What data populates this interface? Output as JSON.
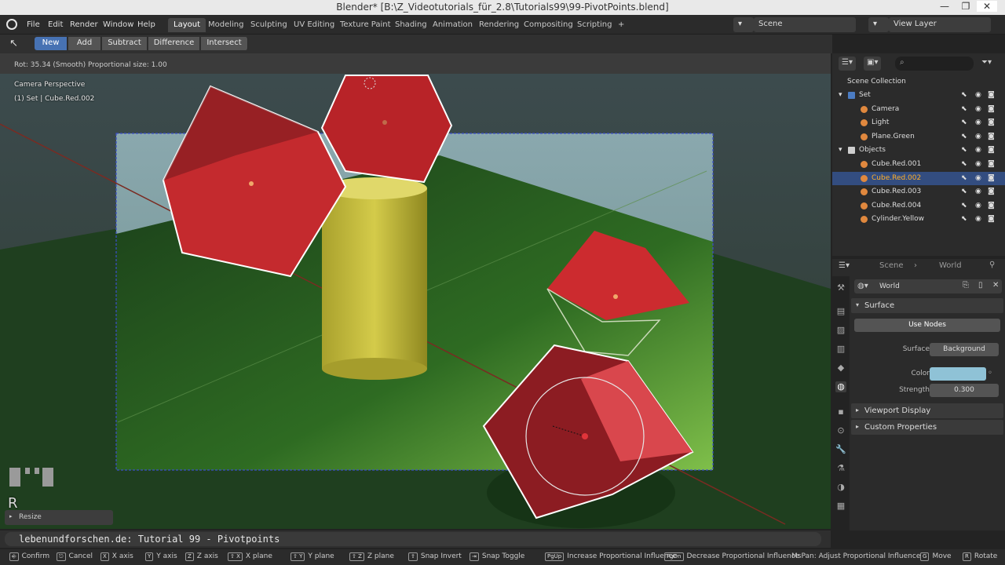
{
  "window": {
    "title": "Blender* [B:\\Z_Videotutorials_für_2.8\\Tutorials99\\99-PivotPoints.blend]",
    "minimize": "—",
    "maximize": "❐",
    "close": "✕"
  },
  "menu": [
    "File",
    "Edit",
    "Render",
    "Window",
    "Help"
  ],
  "workspaces": [
    "Layout",
    "Modeling",
    "Sculpting",
    "UV Editing",
    "Texture Paint",
    "Shading",
    "Animation",
    "Rendering",
    "Compositing",
    "Scripting",
    "+"
  ],
  "scene": "Scene",
  "view_layer": "View Layer",
  "toolbar": {
    "modes": [
      "New",
      "Add",
      "Subtract",
      "Difference",
      "Intersect"
    ],
    "active": "New"
  },
  "viewport": {
    "header_info": "Rot: 35.34 (Smooth) Proportional size: 1.00",
    "camera_label": "Camera Perspective",
    "object_label": "(1) Set | Cube.Red.002",
    "key_overlay": "R",
    "resize_label": "Resize"
  },
  "outliner": {
    "root": "Scene Collection",
    "rows": [
      {
        "label": "Set",
        "kind": "collection",
        "indent": 0,
        "color": "#4b7cc3"
      },
      {
        "label": "Camera",
        "kind": "object",
        "indent": 1,
        "color": "#e0883e"
      },
      {
        "label": "Light",
        "kind": "object",
        "indent": 1,
        "color": "#e0883e"
      },
      {
        "label": "Plane.Green",
        "kind": "object",
        "indent": 1,
        "color": "#e0883e"
      },
      {
        "label": "Objects",
        "kind": "collection",
        "indent": 0,
        "color": "#cfcfcf"
      },
      {
        "label": "Cube.Red.001",
        "kind": "object",
        "indent": 1,
        "color": "#e0883e"
      },
      {
        "label": "Cube.Red.002",
        "kind": "object",
        "indent": 1,
        "color": "#e0883e",
        "selected": true
      },
      {
        "label": "Cube.Red.003",
        "kind": "object",
        "indent": 1,
        "color": "#e0883e"
      },
      {
        "label": "Cube.Red.004",
        "kind": "object",
        "indent": 1,
        "color": "#e0883e"
      },
      {
        "label": "Cylinder.Yellow",
        "kind": "object",
        "indent": 1,
        "color": "#e0883e"
      }
    ]
  },
  "properties": {
    "breadcrumb": [
      "Scene",
      "World"
    ],
    "world_name": "World",
    "panels": {
      "surface": "Surface",
      "viewport_display": "Viewport Display",
      "custom_properties": "Custom Properties"
    },
    "use_nodes": "Use Nodes",
    "fields": {
      "surface_label": "Surface",
      "surface_value": "Background",
      "color_label": "Color",
      "color_value": "#8fc2d6",
      "strength_label": "Strength",
      "strength_value": "0.300"
    }
  },
  "command_line": "lebenundforschen.de: Tutorial 99 - Pivotpoints",
  "status": [
    {
      "key": "⎆",
      "label": "Confirm"
    },
    {
      "key": "⎋",
      "label": "Cancel"
    },
    {
      "key": "X",
      "label": "X axis"
    },
    {
      "key": "Y",
      "label": "Y axis"
    },
    {
      "key": "Z",
      "label": "Z axis"
    },
    {
      "key": "⇧ X",
      "label": "X plane"
    },
    {
      "key": "⇧ Y",
      "label": "Y plane"
    },
    {
      "key": "⇧ Z",
      "label": "Z plane"
    },
    {
      "key": "⇪",
      "label": "Snap Invert"
    },
    {
      "key": "⇥",
      "label": "Snap Toggle"
    },
    {
      "key": "PgUp",
      "label": "Increase Proportional Influence"
    },
    {
      "key": "PgDn",
      "label": "Decrease Proportional Influence"
    },
    {
      "key": "",
      "label": "MsPan: Adjust Proportional Influence"
    },
    {
      "key": "G",
      "label": "Move"
    },
    {
      "key": "R",
      "label": "Rotate"
    }
  ]
}
